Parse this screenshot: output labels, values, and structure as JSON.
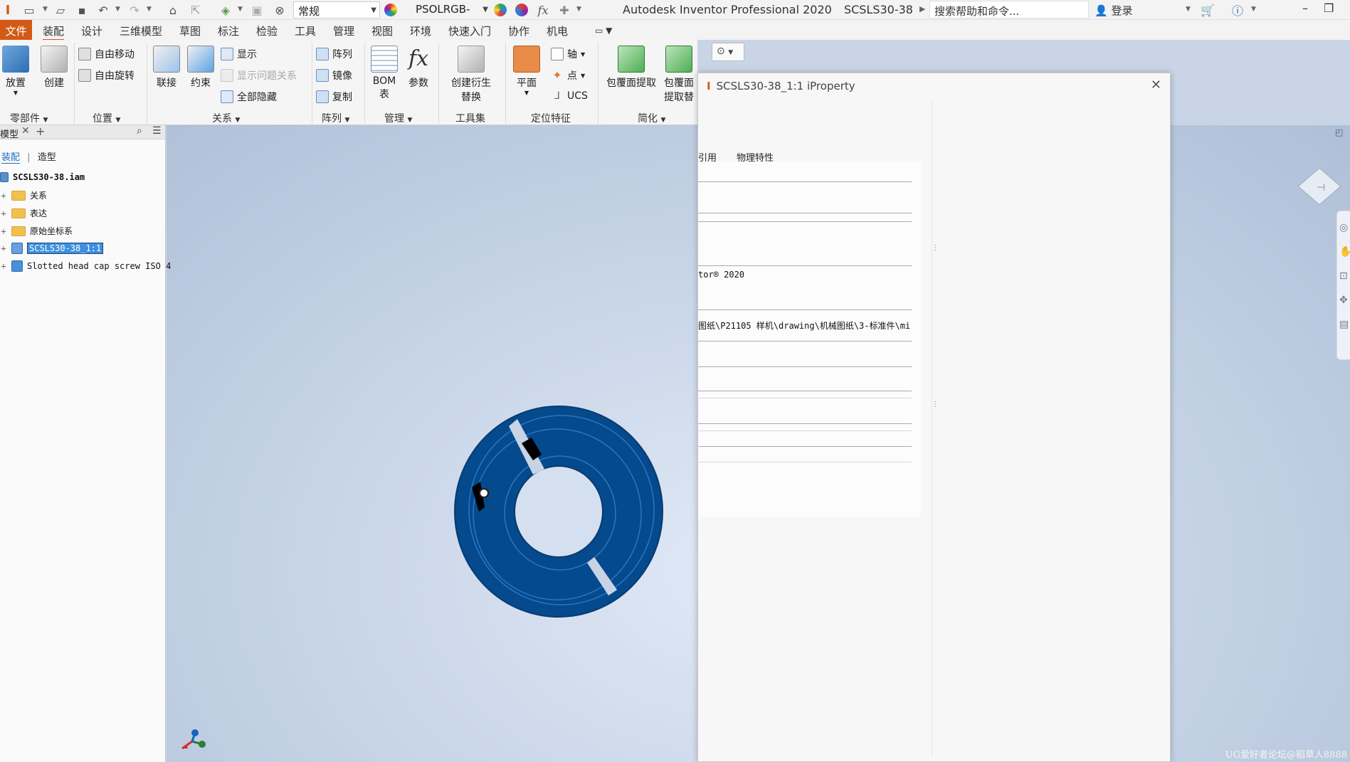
{
  "titlebar": {
    "style_combo": "常规",
    "material_combo": "PSOLRGB-",
    "app_title": "Autodesk Inventor Professional 2020",
    "doc_title": "SCSLS30-38",
    "help_search": "搜索帮助和命令...",
    "login": "登录"
  },
  "menu": {
    "file": "文件",
    "tabs": [
      "装配",
      "设计",
      "三维模型",
      "草图",
      "标注",
      "检验",
      "工具",
      "管理",
      "视图",
      "环境",
      "快速入门",
      "协作",
      "机电"
    ]
  },
  "ribbon": {
    "place": "放置",
    "create": "创建",
    "free_move": "自由移动",
    "free_rotate": "自由旋转",
    "joint": "联接",
    "constrain": "约束",
    "show": "显示",
    "show_problem": "显示问题关系",
    "hide_all": "全部隐藏",
    "pattern": "阵列",
    "mirror": "镜像",
    "copy": "复制",
    "bom": "BOM",
    "bom_sub": "表",
    "params": "参数",
    "create_derived": "创建衍生",
    "substitute": "替换",
    "plane": "平面",
    "axis": "轴",
    "point": "点",
    "ucs": "UCS",
    "shrinkwrap": "包覆面提取",
    "shrinkwrap2a": "包覆面",
    "shrinkwrap2b": "提取替",
    "panels": {
      "component": "零部件",
      "position": "位置",
      "relationships": "关系",
      "pattern": "阵列",
      "manage": "管理",
      "toolset": "工具集",
      "work_features": "定位特征",
      "simplify": "简化"
    }
  },
  "browser": {
    "tab_label": "模型",
    "sub_tabs": [
      "装配",
      "造型"
    ],
    "items": [
      {
        "label": "SCSLS30-38.iam"
      },
      {
        "label": "关系"
      },
      {
        "label": "表达"
      },
      {
        "label": "原始坐标系"
      },
      {
        "label": "SCSLS30-38_1:1"
      },
      {
        "label": "Slotted head cap screw ISO 4"
      }
    ]
  },
  "dialog": {
    "title": "SCSLS30-38_1:1 iProperty",
    "tabs": [
      "引用",
      "物理特性"
    ],
    "values": [
      "tor® 2020",
      "图纸\\P21105 样机\\drawing\\机械图纸\\3-标准件\\mi"
    ]
  },
  "watermark": "UG爱好者论坛@稻草人8888"
}
